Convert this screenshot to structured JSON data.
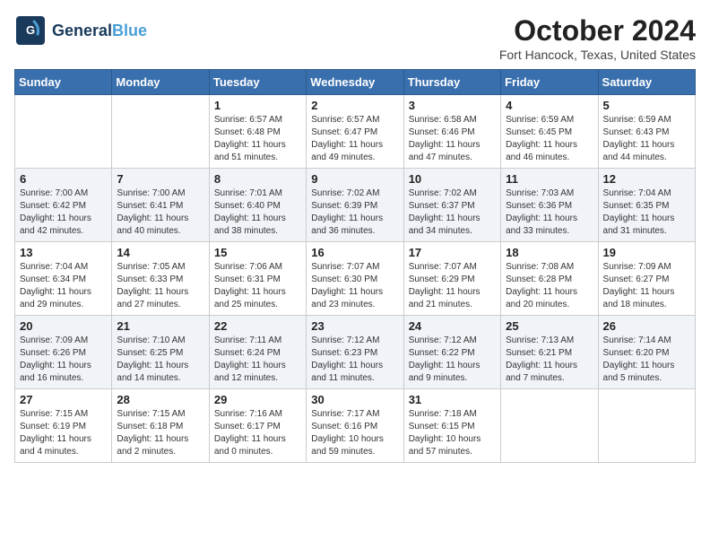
{
  "header": {
    "logo_line1": "General",
    "logo_line2": "Blue",
    "month": "October 2024",
    "location": "Fort Hancock, Texas, United States"
  },
  "weekdays": [
    "Sunday",
    "Monday",
    "Tuesday",
    "Wednesday",
    "Thursday",
    "Friday",
    "Saturday"
  ],
  "weeks": [
    [
      {
        "day": "",
        "info": ""
      },
      {
        "day": "",
        "info": ""
      },
      {
        "day": "1",
        "info": "Sunrise: 6:57 AM\nSunset: 6:48 PM\nDaylight: 11 hours\nand 51 minutes."
      },
      {
        "day": "2",
        "info": "Sunrise: 6:57 AM\nSunset: 6:47 PM\nDaylight: 11 hours\nand 49 minutes."
      },
      {
        "day": "3",
        "info": "Sunrise: 6:58 AM\nSunset: 6:46 PM\nDaylight: 11 hours\nand 47 minutes."
      },
      {
        "day": "4",
        "info": "Sunrise: 6:59 AM\nSunset: 6:45 PM\nDaylight: 11 hours\nand 46 minutes."
      },
      {
        "day": "5",
        "info": "Sunrise: 6:59 AM\nSunset: 6:43 PM\nDaylight: 11 hours\nand 44 minutes."
      }
    ],
    [
      {
        "day": "6",
        "info": "Sunrise: 7:00 AM\nSunset: 6:42 PM\nDaylight: 11 hours\nand 42 minutes."
      },
      {
        "day": "7",
        "info": "Sunrise: 7:00 AM\nSunset: 6:41 PM\nDaylight: 11 hours\nand 40 minutes."
      },
      {
        "day": "8",
        "info": "Sunrise: 7:01 AM\nSunset: 6:40 PM\nDaylight: 11 hours\nand 38 minutes."
      },
      {
        "day": "9",
        "info": "Sunrise: 7:02 AM\nSunset: 6:39 PM\nDaylight: 11 hours\nand 36 minutes."
      },
      {
        "day": "10",
        "info": "Sunrise: 7:02 AM\nSunset: 6:37 PM\nDaylight: 11 hours\nand 34 minutes."
      },
      {
        "day": "11",
        "info": "Sunrise: 7:03 AM\nSunset: 6:36 PM\nDaylight: 11 hours\nand 33 minutes."
      },
      {
        "day": "12",
        "info": "Sunrise: 7:04 AM\nSunset: 6:35 PM\nDaylight: 11 hours\nand 31 minutes."
      }
    ],
    [
      {
        "day": "13",
        "info": "Sunrise: 7:04 AM\nSunset: 6:34 PM\nDaylight: 11 hours\nand 29 minutes."
      },
      {
        "day": "14",
        "info": "Sunrise: 7:05 AM\nSunset: 6:33 PM\nDaylight: 11 hours\nand 27 minutes."
      },
      {
        "day": "15",
        "info": "Sunrise: 7:06 AM\nSunset: 6:31 PM\nDaylight: 11 hours\nand 25 minutes."
      },
      {
        "day": "16",
        "info": "Sunrise: 7:07 AM\nSunset: 6:30 PM\nDaylight: 11 hours\nand 23 minutes."
      },
      {
        "day": "17",
        "info": "Sunrise: 7:07 AM\nSunset: 6:29 PM\nDaylight: 11 hours\nand 21 minutes."
      },
      {
        "day": "18",
        "info": "Sunrise: 7:08 AM\nSunset: 6:28 PM\nDaylight: 11 hours\nand 20 minutes."
      },
      {
        "day": "19",
        "info": "Sunrise: 7:09 AM\nSunset: 6:27 PM\nDaylight: 11 hours\nand 18 minutes."
      }
    ],
    [
      {
        "day": "20",
        "info": "Sunrise: 7:09 AM\nSunset: 6:26 PM\nDaylight: 11 hours\nand 16 minutes."
      },
      {
        "day": "21",
        "info": "Sunrise: 7:10 AM\nSunset: 6:25 PM\nDaylight: 11 hours\nand 14 minutes."
      },
      {
        "day": "22",
        "info": "Sunrise: 7:11 AM\nSunset: 6:24 PM\nDaylight: 11 hours\nand 12 minutes."
      },
      {
        "day": "23",
        "info": "Sunrise: 7:12 AM\nSunset: 6:23 PM\nDaylight: 11 hours\nand 11 minutes."
      },
      {
        "day": "24",
        "info": "Sunrise: 7:12 AM\nSunset: 6:22 PM\nDaylight: 11 hours\nand 9 minutes."
      },
      {
        "day": "25",
        "info": "Sunrise: 7:13 AM\nSunset: 6:21 PM\nDaylight: 11 hours\nand 7 minutes."
      },
      {
        "day": "26",
        "info": "Sunrise: 7:14 AM\nSunset: 6:20 PM\nDaylight: 11 hours\nand 5 minutes."
      }
    ],
    [
      {
        "day": "27",
        "info": "Sunrise: 7:15 AM\nSunset: 6:19 PM\nDaylight: 11 hours\nand 4 minutes."
      },
      {
        "day": "28",
        "info": "Sunrise: 7:15 AM\nSunset: 6:18 PM\nDaylight: 11 hours\nand 2 minutes."
      },
      {
        "day": "29",
        "info": "Sunrise: 7:16 AM\nSunset: 6:17 PM\nDaylight: 11 hours\nand 0 minutes."
      },
      {
        "day": "30",
        "info": "Sunrise: 7:17 AM\nSunset: 6:16 PM\nDaylight: 10 hours\nand 59 minutes."
      },
      {
        "day": "31",
        "info": "Sunrise: 7:18 AM\nSunset: 6:15 PM\nDaylight: 10 hours\nand 57 minutes."
      },
      {
        "day": "",
        "info": ""
      },
      {
        "day": "",
        "info": ""
      }
    ]
  ]
}
